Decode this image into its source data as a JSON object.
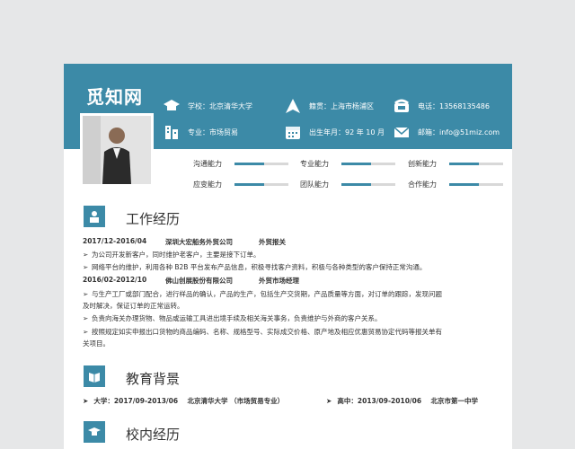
{
  "brand": "觅知网",
  "info": {
    "school": "学校：北京清华大学",
    "origin": "籍贯：上海市杨浦区",
    "phone": "电话：13568135486",
    "major": "专业：市场贸易",
    "birth": "出生年月：92 年 10 月",
    "email": "邮箱：info@51miz.com"
  },
  "skills": [
    {
      "label": "沟通能力",
      "level": 0.55
    },
    {
      "label": "专业能力",
      "level": 0.55
    },
    {
      "label": "创新能力",
      "level": 0.55
    },
    {
      "label": "应变能力",
      "level": 0.55
    },
    {
      "label": "团队能力",
      "level": 0.55
    },
    {
      "label": "合作能力",
      "level": 0.55
    }
  ],
  "work": {
    "title": "工作经历",
    "jobs": [
      {
        "date": "2017/12-2016/04",
        "company": "深圳大宏船务外贸公司",
        "role": "外贸报关",
        "bullets": [
          "为公司开发新客户，同时维护老客户，主要是接下订单。",
          "网络平台的维护，利用各种 B2B 平台发布产品信息，积极寻找客户资料，积极与各种类型的客户保持正常沟通。"
        ]
      },
      {
        "date": "2016/02-2012/10",
        "company": "佛山创展股份有限公司",
        "role": "外贸市场经理",
        "bullets": [
          "与生产工厂或部门配合，进行样品的确认，产品的生产，包括生产交货期，产品质量等方面，对订单的跟踪，发现问题\n及时解决，保证订单的正常运转。",
          "负责向海关办理货物、物品或运输工具进出境手续及相关海关事务，负责维护与外商的客户关系。",
          "按照规定如实申报出口货物的商品编码、名称、规格型号、实际成交价格、原产地及相应优惠贸易协定代码等报关单有\n关项目。"
        ]
      }
    ]
  },
  "education": {
    "title": "教育背景",
    "items": [
      {
        "label": "大学：2017/09-2013/06",
        "school": "北京清华大学 （市场贸易专业）"
      },
      {
        "label": "高中：2013/09-2010/06",
        "school": "北京市第一中学"
      }
    ]
  },
  "campus": {
    "title": "校内经历"
  },
  "colors": {
    "accent": "#3c8aa7",
    "background": "#e6e7e8"
  },
  "icons": [
    "graduation-cap-icon",
    "location-arrow-icon",
    "phone-icon",
    "building-icon",
    "calendar-icon",
    "mail-icon",
    "person-icon",
    "book-icon"
  ]
}
